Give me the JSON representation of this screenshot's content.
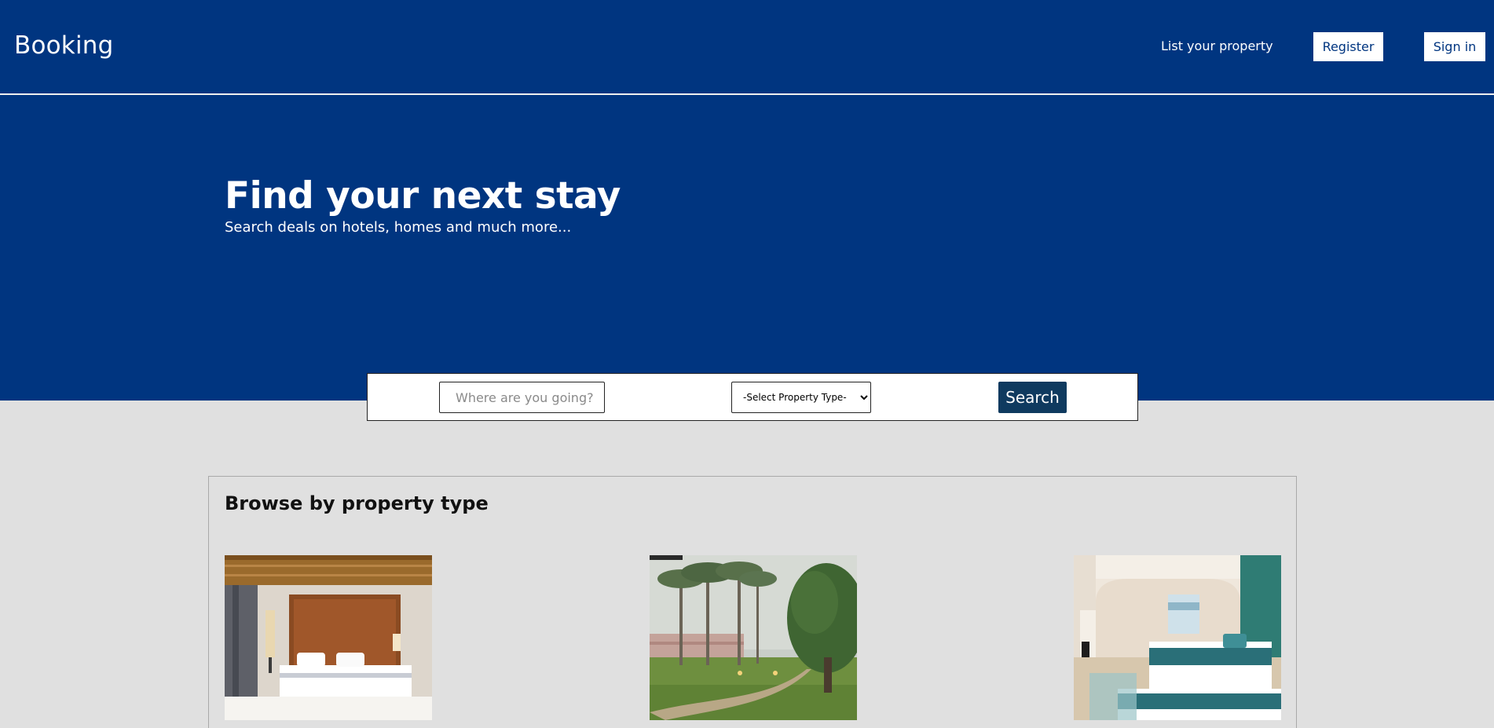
{
  "navbar": {
    "brand": "Booking",
    "list_property": "List your property",
    "register": "Register",
    "sign_in": "Sign in"
  },
  "hero": {
    "title": "Find your next stay",
    "subtitle": "Search deals on hotels, homes and much more..."
  },
  "search": {
    "placeholder": "Where are you going?",
    "select_value": "-Select Property Type-",
    "button": "Search"
  },
  "browse": {
    "title": "Browse by property type",
    "cards": [
      {
        "image": "hotel-room-photo"
      },
      {
        "image": "resort-garden-photo"
      },
      {
        "image": "suite-room-photo"
      }
    ]
  },
  "colors": {
    "brand_blue": "#003580",
    "search_button": "#0f3a5f",
    "page_background": "#e0e0e0"
  }
}
